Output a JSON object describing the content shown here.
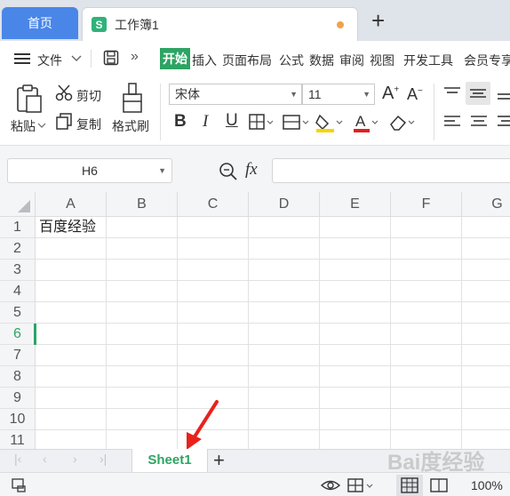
{
  "tabs": {
    "home": "首页",
    "workbook": "工作簿1",
    "workbook_icon": "S",
    "new_tab": "+"
  },
  "menu": {
    "file": "文件",
    "items": [
      "开始",
      "插入",
      "页面布局",
      "公式",
      "数据",
      "审阅",
      "视图",
      "开发工具",
      "会员专享"
    ],
    "active": "开始"
  },
  "ribbon": {
    "paste": "粘贴",
    "cut": "剪切",
    "copy": "复制",
    "format_painter": "格式刷",
    "font_name": "宋体",
    "font_size": "11",
    "bold": "B",
    "italic": "I",
    "underline": "U"
  },
  "formula_bar": {
    "name_box": "H6",
    "fx": "fx",
    "formula": ""
  },
  "grid": {
    "columns": [
      "A",
      "B",
      "C",
      "D",
      "E",
      "F",
      "G"
    ],
    "rows": [
      "1",
      "2",
      "3",
      "4",
      "5",
      "6",
      "7",
      "8",
      "9",
      "10",
      "11"
    ],
    "active_row": "6",
    "cells": {
      "A1": "百度经验"
    }
  },
  "sheets": {
    "tabs": [
      "Sheet1"
    ],
    "add": "+"
  },
  "status": {
    "zoom": "100%"
  },
  "watermark": "Bai度经验",
  "colors": {
    "accent": "#2da463",
    "home_tab": "#4a86e8",
    "arrow": "#e8221b"
  }
}
